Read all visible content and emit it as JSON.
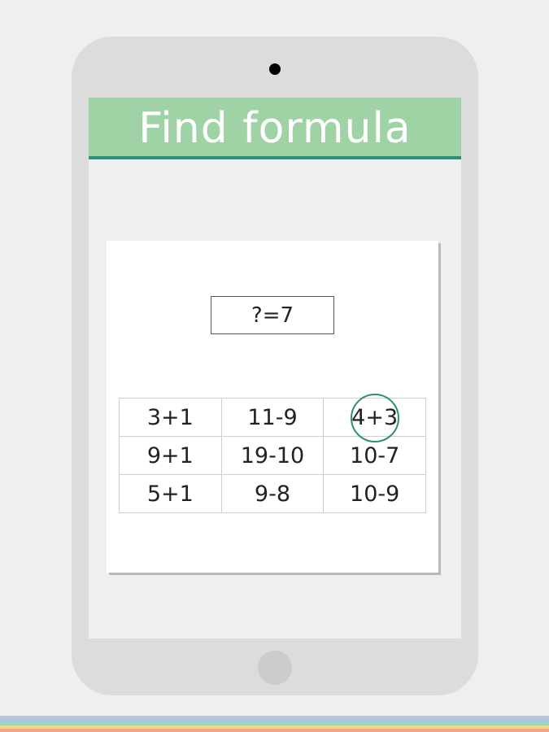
{
  "app": {
    "title": "Find formula"
  },
  "puzzle": {
    "question": "?=7",
    "selected_cell": "4+3",
    "grid": [
      [
        "3+1",
        "11-9",
        "4+3"
      ],
      [
        "9+1",
        "19-10",
        "10-7"
      ],
      [
        "5+1",
        "9-8",
        "10-9"
      ]
    ]
  },
  "colors": {
    "header_bg": "#9fd3a6",
    "header_accent": "#2f8f7a",
    "selection_circle": "#2f8f7a",
    "tablet_frame": "#dcdcdc"
  },
  "icons": {
    "camera": "camera-icon",
    "home": "home-button-icon"
  }
}
